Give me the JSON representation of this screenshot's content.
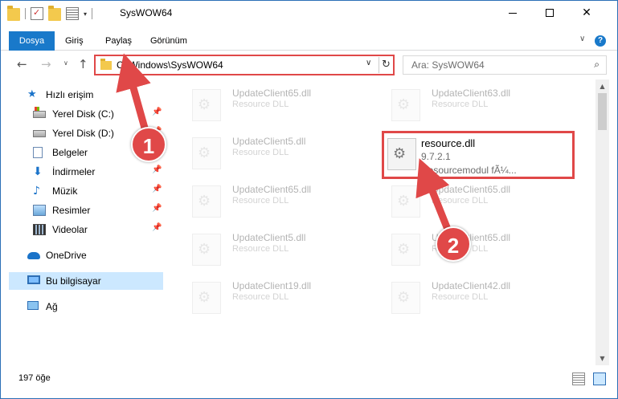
{
  "window": {
    "title": "SysWOW64",
    "controls": {
      "minimize": "–",
      "maximize": "□",
      "close": "✕"
    }
  },
  "ribbon": {
    "tabs": [
      {
        "label": "Dosya"
      },
      {
        "label": "Giriş"
      },
      {
        "label": "Paylaş"
      },
      {
        "label": "Görünüm"
      }
    ],
    "help": "?"
  },
  "nav": {
    "back": "←",
    "forward": "→",
    "recent": "∨",
    "up": "↑",
    "address": "C:\\Windows\\SysWOW64",
    "refresh": "↻",
    "search_placeholder": "Ara: SysWOW64",
    "search_icon": "search-icon"
  },
  "sidebar": {
    "items": [
      {
        "label": "Hızlı erişim",
        "icon": "star-icon"
      },
      {
        "label": "Yerel Disk (C:)",
        "icon": "drive-icon",
        "pinned": true
      },
      {
        "label": "Yerel Disk (D:)",
        "icon": "drive-icon",
        "pinned": true
      },
      {
        "label": "Belgeler",
        "icon": "document-icon",
        "pinned": true
      },
      {
        "label": "İndirmeler",
        "icon": "download-icon",
        "pinned": true
      },
      {
        "label": "Müzik",
        "icon": "music-icon",
        "pinned": true
      },
      {
        "label": "Resimler",
        "icon": "pictures-icon",
        "pinned": true
      },
      {
        "label": "Videolar",
        "icon": "videos-icon",
        "pinned": true
      },
      {
        "label": "OneDrive",
        "icon": "cloud-icon"
      },
      {
        "label": "Bu bilgisayar",
        "icon": "computer-icon",
        "selected": true
      },
      {
        "label": "Ağ",
        "icon": "network-icon"
      }
    ],
    "pin_glyph": "📌"
  },
  "files": [
    {
      "name": "UpdateClient65.dll",
      "desc": "Resource DLL",
      "faded": true
    },
    {
      "name": "UpdateClient63.dll",
      "desc": "Resource DLL",
      "faded": true
    },
    {
      "name": "UpdateClient5.dll",
      "desc": "Resource DLL",
      "faded": true
    },
    {
      "name": "resource.dll",
      "version": "9.7.2.1",
      "desc": "Resourcemodul fÃ¼...",
      "highlighted": true
    },
    {
      "name": "UpdateClient65.dll",
      "desc": "Resource DLL",
      "faded": true
    },
    {
      "name": "UpdateClient65.dll",
      "desc": "Resource DLL",
      "faded": true
    },
    {
      "name": "UpdateClient5.dll",
      "desc": "Resource DLL",
      "faded": true
    },
    {
      "name": "UpdateClient65.dll",
      "desc": "Resource DLL",
      "faded": true
    },
    {
      "name": "UpdateClient19.dll",
      "desc": "Resource DLL",
      "faded": true
    },
    {
      "name": "UpdateClient42.dll",
      "desc": "Resource DLL",
      "faded": true
    }
  ],
  "scrollbar": {
    "up": "▲",
    "down": "▼"
  },
  "status": {
    "count": "197 öğe"
  },
  "annotations": {
    "step1": "1",
    "step2": "2",
    "color": "#e04848"
  },
  "colors": {
    "accent": "#1979ca",
    "selected_bg": "#cce8ff",
    "highlight": "#e04848"
  }
}
